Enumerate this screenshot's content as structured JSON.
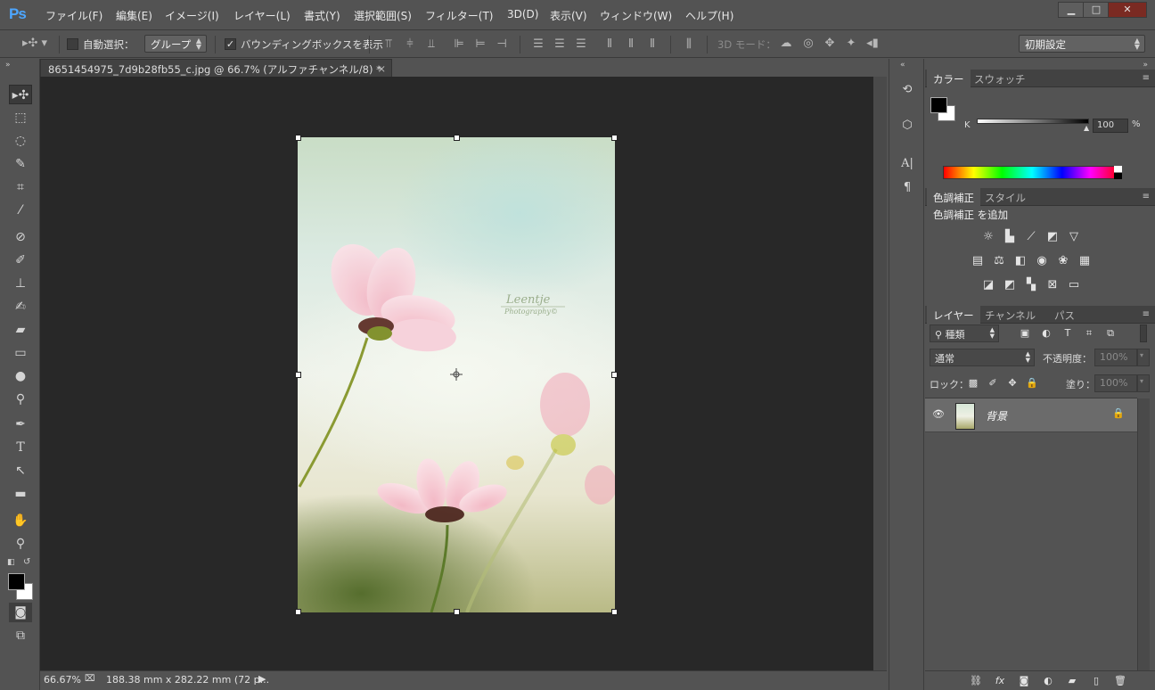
{
  "app": {
    "logo": "Ps"
  },
  "menu": [
    "ファイル(F)",
    "編集(E)",
    "イメージ(I)",
    "レイヤー(L)",
    "書式(Y)",
    "選択範囲(S)",
    "フィルター(T)",
    "3D(D)",
    "表示(V)",
    "ウィンドウ(W)",
    "ヘルプ(H)"
  ],
  "window_controls": {
    "minimize": "▁",
    "maximize": "□",
    "close": "✕"
  },
  "options": {
    "auto_select_label": "自動選択：",
    "auto_select_checked": false,
    "auto_select_value": "グループ",
    "bounding_box_label": "バウンディングボックスを表示",
    "bounding_box_checked": true,
    "mode_3d_label": "3D モード：",
    "workspace": "初期設定"
  },
  "document": {
    "tab_title": "8651454975_7d9b28fb55_c.jpg @ 66.7% (アルファチャンネル/8) *",
    "tab_close": "×",
    "watermark_name": "Leentje",
    "watermark_sub": "Photography©"
  },
  "status": {
    "zoom": "66.67%",
    "doc_info": "188.38 mm x 282.22 mm (72 p..."
  },
  "color_panel": {
    "tabs": [
      "カラー",
      "スウォッチ"
    ],
    "channel": "K",
    "value": "100",
    "unit": "%",
    "foreground": "#000000",
    "background": "#ffffff"
  },
  "adjustments_panel": {
    "tabs": [
      "色調補正",
      "スタイル"
    ],
    "heading": "色調補正 を追加"
  },
  "layers_panel": {
    "tabs": [
      "レイヤー",
      "チャンネル",
      "パス"
    ],
    "filter_label": "種類",
    "blend_mode": "通常",
    "opacity_label": "不透明度：",
    "opacity_value": "100%",
    "lock_label": "ロック：",
    "fill_label": "塗り：",
    "fill_value": "100%",
    "layers": [
      {
        "name": "背景",
        "visible": true,
        "locked": true
      }
    ]
  }
}
